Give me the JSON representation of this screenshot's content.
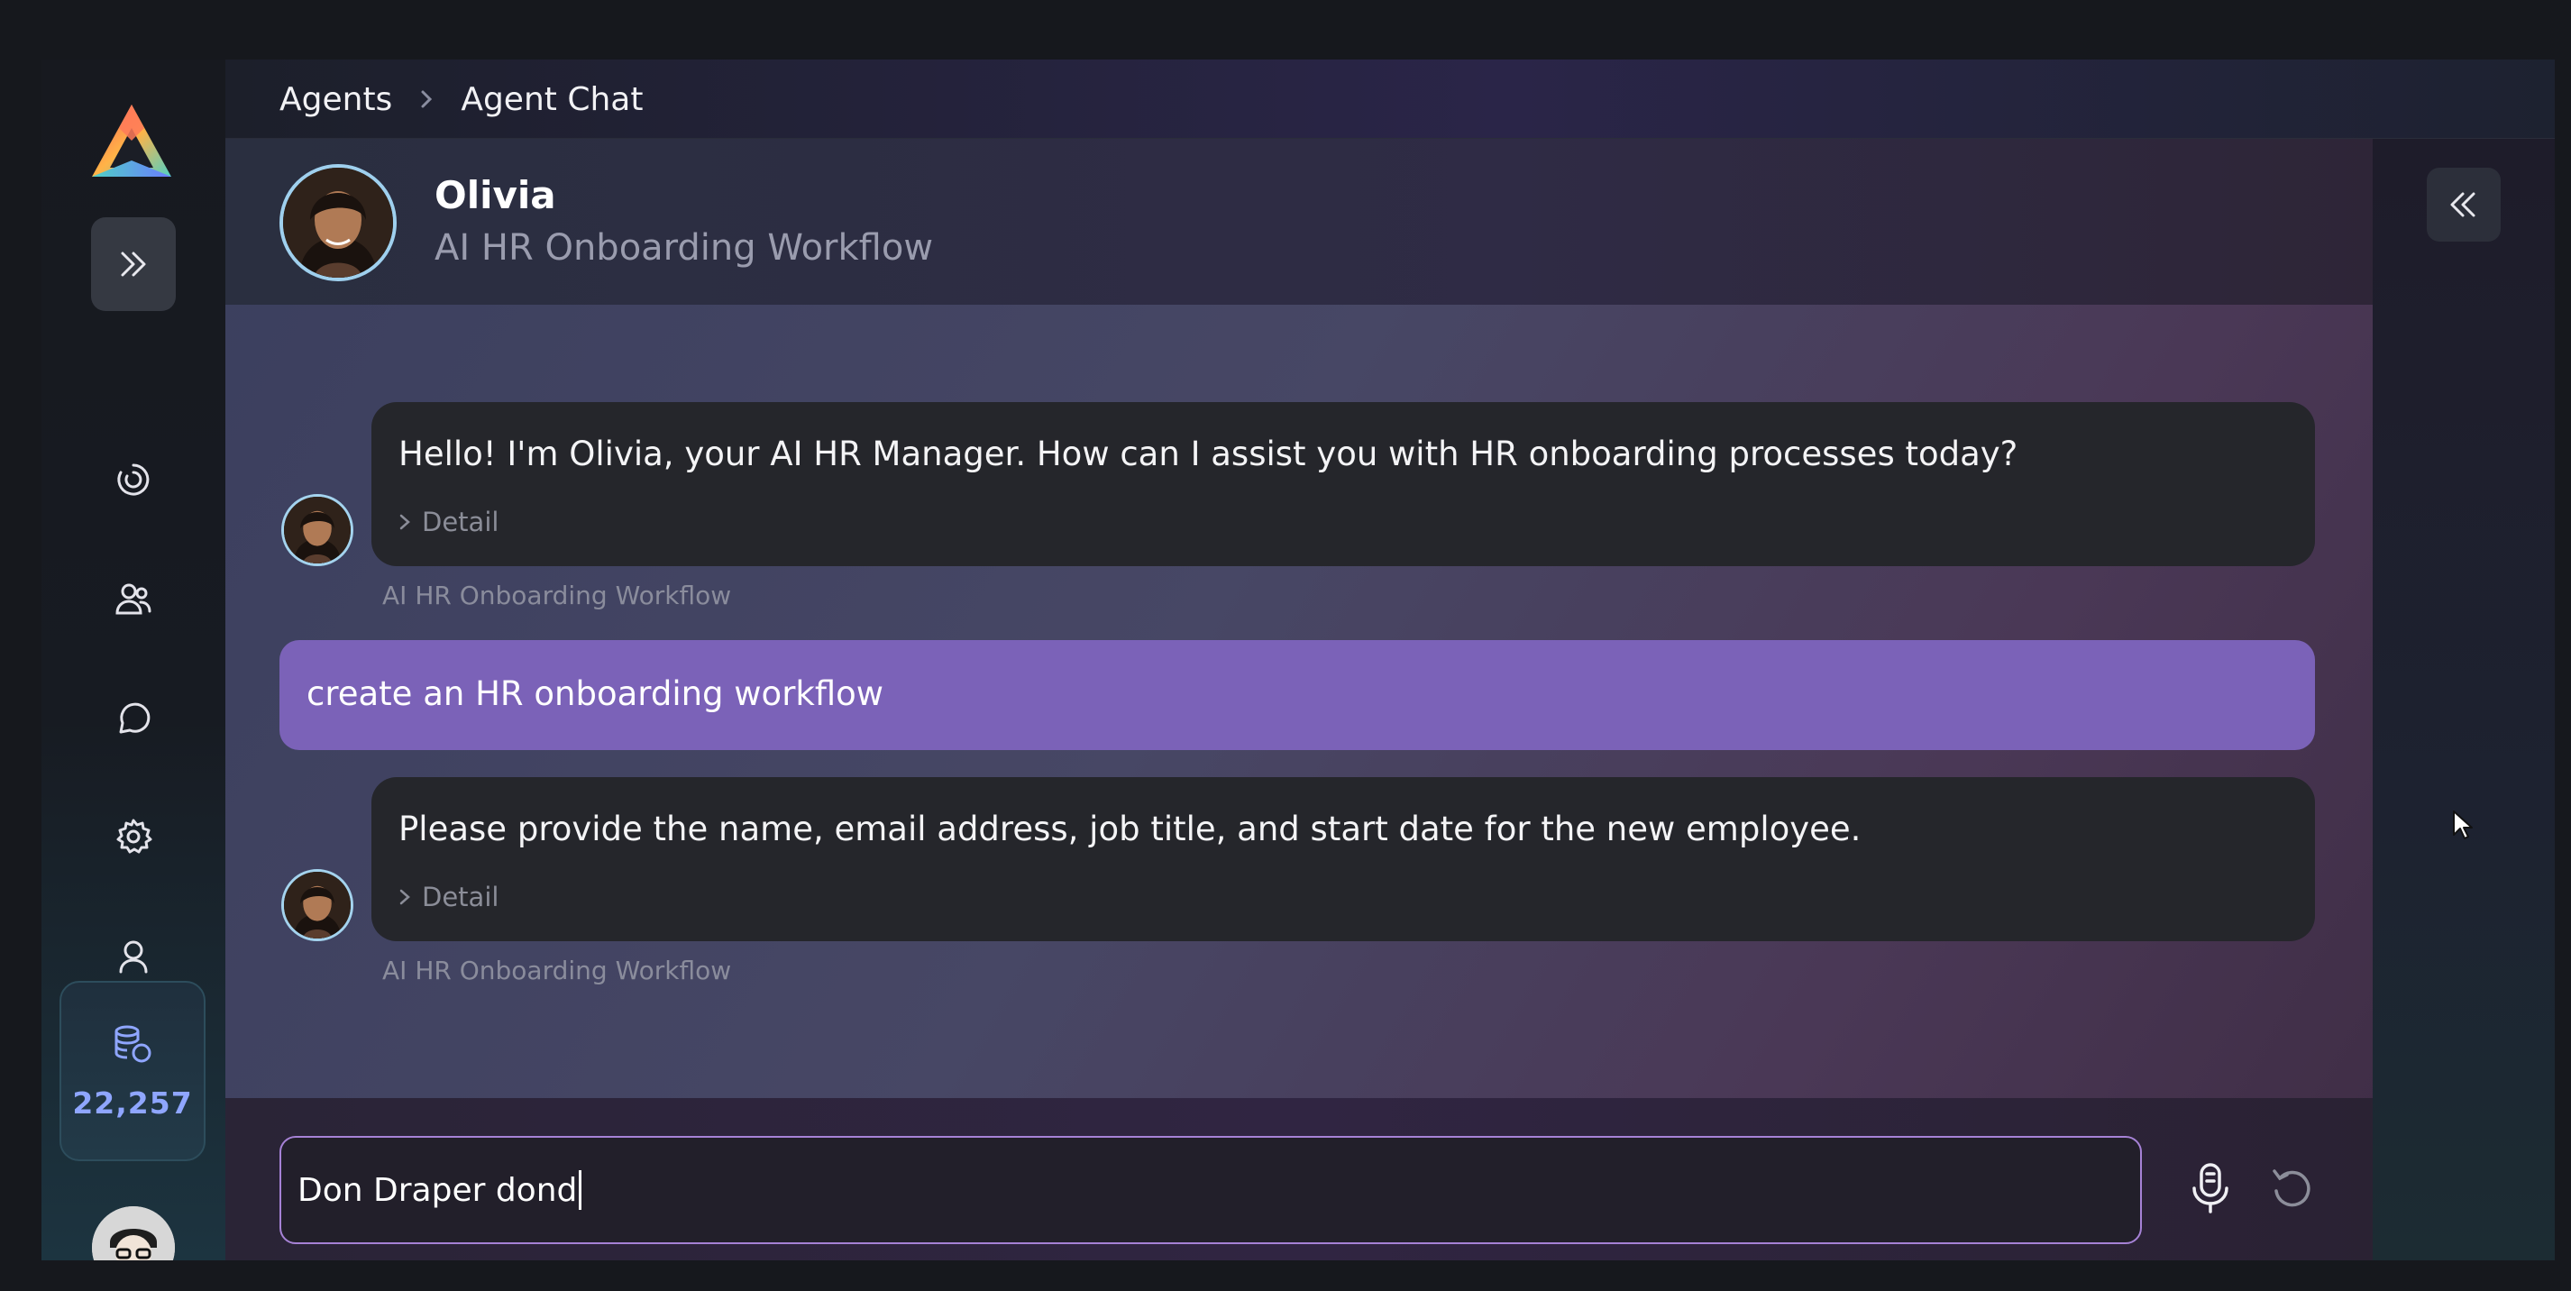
{
  "breadcrumb": {
    "items": [
      "Agents",
      "Agent Chat"
    ]
  },
  "agent": {
    "name": "Olivia",
    "role": "AI HR Onboarding Workflow"
  },
  "messages": [
    {
      "sender": "agent",
      "text": "Hello! I'm Olivia, your AI HR Manager. How can I assist you with HR onboarding processes today?",
      "detail_label": "Detail",
      "source": "AI HR Onboarding Workflow"
    },
    {
      "sender": "user",
      "text": "create an HR onboarding workflow"
    },
    {
      "sender": "agent",
      "text": "Please provide the name, email address, job title, and start date for the new employee.",
      "detail_label": "Detail",
      "source": "AI HR Onboarding Workflow"
    }
  ],
  "composer": {
    "value": "Don Draper dond"
  },
  "credits": {
    "value": "22,257"
  },
  "colors": {
    "user_bubble": "#7b62b8",
    "agent_bubble": "#25262b",
    "credits_text": "#8fa6ff",
    "avatar_ring": "#9fd0ee"
  },
  "icons": {
    "sidebar": [
      "expand-icon",
      "dashboard-icon",
      "users-icon",
      "chat-icon",
      "settings-icon",
      "profile-icon"
    ],
    "credits": "database-icon",
    "composer": [
      "microphone-icon",
      "reset-icon"
    ],
    "panel": "collapse-icon"
  }
}
